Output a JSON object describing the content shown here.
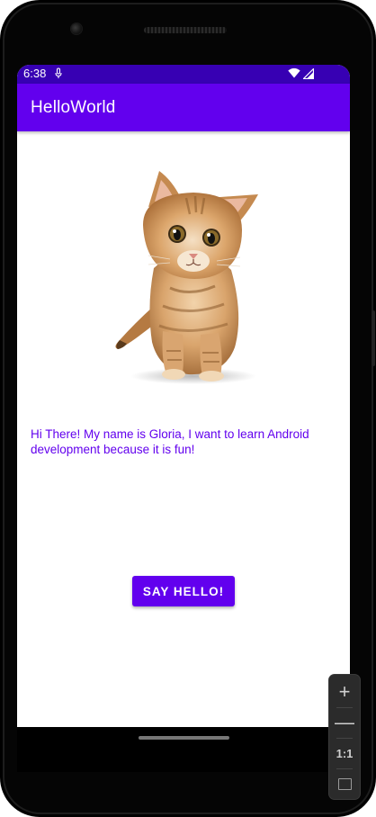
{
  "status_bar": {
    "time": "6:38",
    "icons": [
      "mic-icon",
      "wifi-icon",
      "signal-icon"
    ],
    "background_color": "#3700b3"
  },
  "app_bar": {
    "title": "HelloWorld",
    "background_color": "#6200ee"
  },
  "main": {
    "image": "kitten-photo",
    "intro_text": "Hi There! My name is Gloria, I want to learn Android development because it is fun!",
    "text_color": "#6200ee",
    "button_label": "SAY HELLO!",
    "button_color": "#6200ee"
  },
  "emulator_controls": {
    "zoom_in_icon": "+",
    "zoom_out_icon": "—",
    "zoom_reset_label": "1:1",
    "fit_icon": "fit-screen-icon"
  }
}
